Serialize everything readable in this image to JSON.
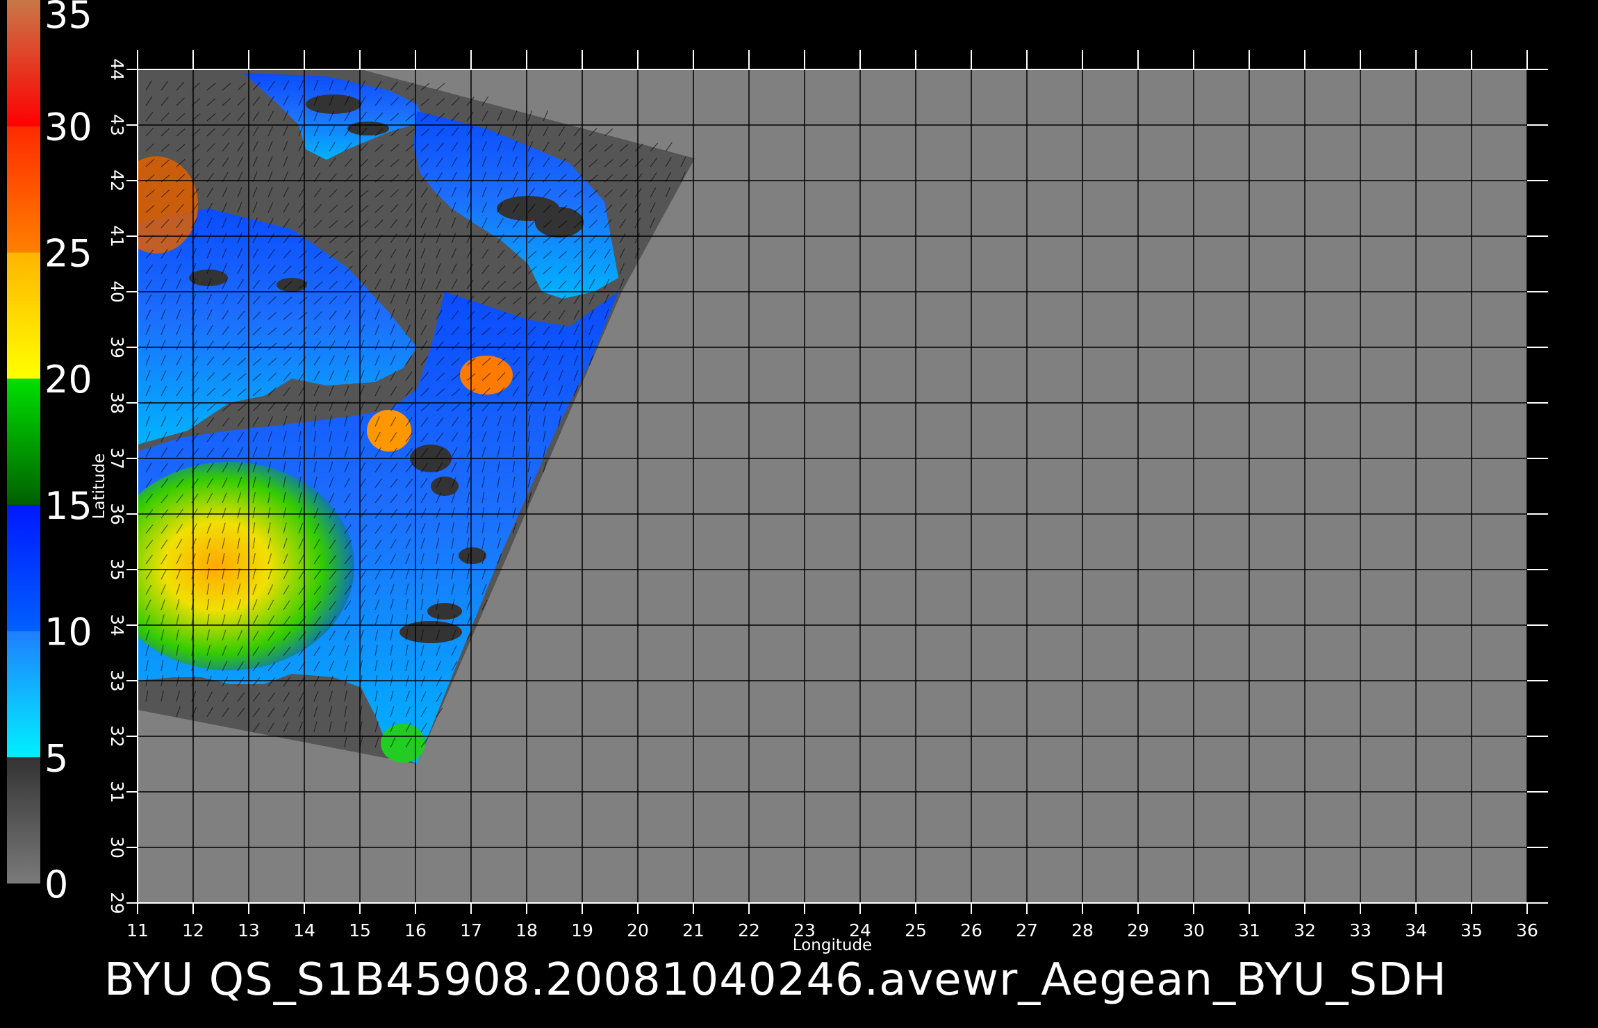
{
  "figure": {
    "caption": "BYU  QS_S1B45908.20081040246.avewr_Aegean_BYU_SDH",
    "background_color": "#000000",
    "grid_color": "#000000",
    "land_color": "#808080",
    "swath_nodata_color": "#555555"
  },
  "axes": {
    "xlabel": "Longitude",
    "ylabel": "Latitude",
    "xlim": [
      11,
      36
    ],
    "ylim": [
      29,
      44
    ],
    "x_ticks": [
      "11",
      "12",
      "13",
      "14",
      "15",
      "16",
      "17",
      "18",
      "19",
      "20",
      "21",
      "22",
      "23",
      "24",
      "25",
      "26",
      "27",
      "28",
      "29",
      "30",
      "31",
      "32",
      "33",
      "34",
      "35",
      "36"
    ],
    "y_ticks": [
      "29",
      "30",
      "31",
      "32",
      "33",
      "34",
      "35",
      "36",
      "37",
      "38",
      "39",
      "40",
      "41",
      "42",
      "43",
      "44"
    ]
  },
  "colorbar": {
    "labels": [
      "35",
      "30",
      "25",
      "20",
      "15",
      "10",
      "5",
      "0"
    ],
    "range": [
      0,
      35
    ],
    "segments": [
      {
        "from": 0,
        "to": 5,
        "top": "#333333",
        "bottom": "#7a7a7a"
      },
      {
        "from": 5,
        "to": 10,
        "top": "#1f7fff",
        "bottom": "#00f0ff"
      },
      {
        "from": 10,
        "to": 15,
        "top": "#0018ff",
        "bottom": "#0060ff"
      },
      {
        "from": 15,
        "to": 20,
        "top": "#00e000",
        "bottom": "#006000"
      },
      {
        "from": 20,
        "to": 25,
        "top": "#ffb400",
        "bottom": "#ffff00"
      },
      {
        "from": 25,
        "to": 30,
        "top": "#ff2a00",
        "bottom": "#ff8000"
      },
      {
        "from": 30,
        "to": 35,
        "top": "#c87848",
        "bottom": "#ff0000"
      }
    ]
  }
}
